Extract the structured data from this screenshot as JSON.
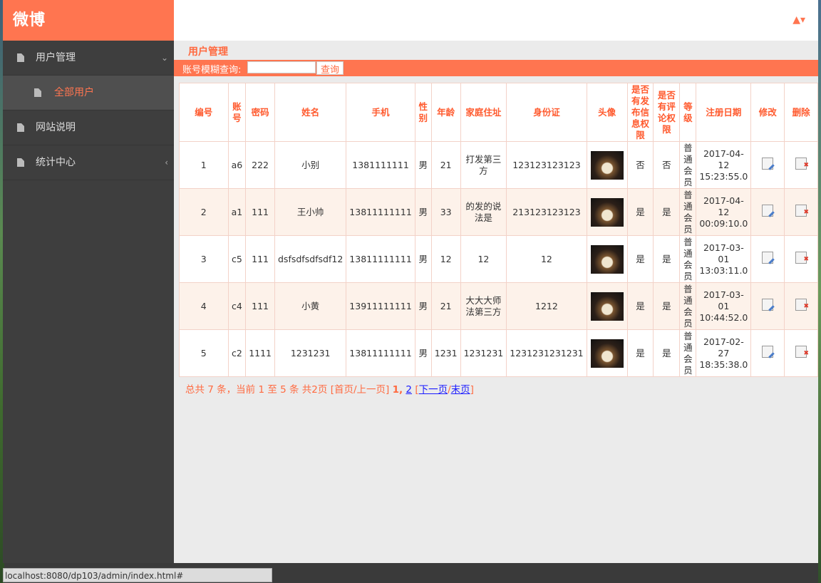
{
  "brand": "微博",
  "sidebar": {
    "items": [
      {
        "label": "用户管理",
        "arrow": "⌄"
      },
      {
        "label": "全部用户"
      },
      {
        "label": "网站说明"
      },
      {
        "label": "统计中心",
        "arrow": "‹"
      }
    ]
  },
  "header": {
    "user_icon": "▲▾"
  },
  "page_title": "用户管理",
  "search": {
    "label": "账号模糊查询:",
    "value": "",
    "button": "查询"
  },
  "table": {
    "headers": [
      "编号",
      "账号",
      "密码",
      "姓名",
      "手机",
      "性别",
      "年龄",
      "家庭住址",
      "身份证",
      "头像",
      "是否有发布信息权限",
      "是否有评论权限",
      "等级",
      "注册日期",
      "修改",
      "删除"
    ],
    "rows": [
      {
        "id": "1",
        "account": "a6",
        "password": "222",
        "name": "小别",
        "phone": "1381111111",
        "gender": "男",
        "age": "21",
        "address": "打发第三方",
        "idcard": "123123123123",
        "post_perm": "否",
        "comment_perm": "否",
        "level": "普通会员",
        "date": "2017-04-12 15:23:55.0"
      },
      {
        "id": "2",
        "account": "a1",
        "password": "111",
        "name": "王小帅",
        "phone": "13811111111",
        "gender": "男",
        "age": "33",
        "address": "的发的说法是",
        "idcard": "213123123123",
        "post_perm": "是",
        "comment_perm": "是",
        "level": "普通会员",
        "date": "2017-04-12 00:09:10.0"
      },
      {
        "id": "3",
        "account": "c5",
        "password": "111",
        "name": "dsfsdfsdfsdf12",
        "phone": "13811111111",
        "gender": "男",
        "age": "12",
        "address": "12",
        "idcard": "12",
        "post_perm": "是",
        "comment_perm": "是",
        "level": "普通会员",
        "date": "2017-03-01 13:03:11.0"
      },
      {
        "id": "4",
        "account": "c4",
        "password": "111",
        "name": "小黄",
        "phone": "13911111111",
        "gender": "男",
        "age": "21",
        "address": "大大大师法第三方",
        "idcard": "1212",
        "post_perm": "是",
        "comment_perm": "是",
        "level": "普通会员",
        "date": "2017-03-01 10:44:52.0"
      },
      {
        "id": "5",
        "account": "c2",
        "password": "1111",
        "name": "1231231",
        "phone": "13811111111",
        "gender": "男",
        "age": "1231",
        "address": "1231231",
        "idcard": "1231231231231",
        "post_perm": "是",
        "comment_perm": "是",
        "level": "普通会员",
        "date": "2017-02-27 18:35:38.0"
      }
    ]
  },
  "pager": {
    "summary": "总共 7 条，当前 1 至 5 条 共2页",
    "first_prev": "[首页/上一页]",
    "page1": "1,",
    "page2": "2",
    "next": "下一页",
    "last": "末页"
  },
  "status_url": "localhost:8080/dp103/admin/index.html#"
}
